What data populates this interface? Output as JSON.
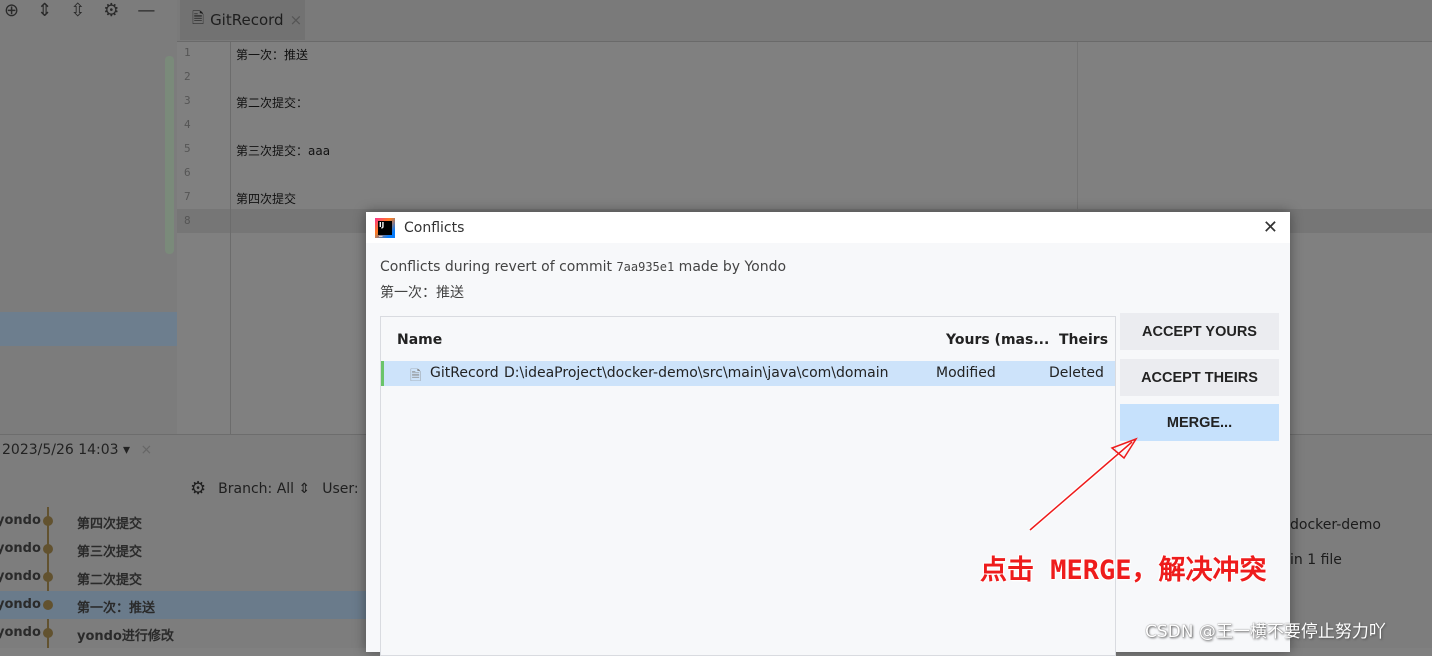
{
  "editor": {
    "tab_label": "GitRecord",
    "lines": [
      {
        "n": "1",
        "text": "第一次：推送"
      },
      {
        "n": "2",
        "text": ""
      },
      {
        "n": "3",
        "text": "第二次提交："
      },
      {
        "n": "4",
        "text": ""
      },
      {
        "n": "5",
        "text": "第三次提交：aaa"
      },
      {
        "n": "6",
        "text": ""
      },
      {
        "n": "7",
        "text": "第四次提交"
      },
      {
        "n": "8",
        "text": ""
      }
    ]
  },
  "log": {
    "date_filter": "2023/5/26 14:03",
    "branch_filter": "Branch: All",
    "user_filter": "User:",
    "commits": [
      {
        "author": "yondo",
        "message": "第四次提交"
      },
      {
        "author": "yondo",
        "message": "第三次提交"
      },
      {
        "author": "yondo",
        "message": "第二次提交"
      },
      {
        "author": "yondo",
        "message": "第一次：推送",
        "selected": true
      },
      {
        "author": "yondo",
        "message": "yondo进行修改"
      }
    ],
    "details": {
      "project": "docker-demo",
      "files": "in  1 file"
    }
  },
  "dialog": {
    "title": "Conflicts",
    "desc_prefix": "Conflicts during revert of commit ",
    "commit_hash": "7aa935e1",
    "desc_suffix": " made by Yondo",
    "commit_message": "第一次：推送",
    "columns": {
      "name": "Name",
      "yours": "Yours (mas...",
      "theirs": "Theirs"
    },
    "rows": [
      {
        "file": "GitRecord",
        "path": "D:\\ideaProject\\docker-demo\\src\\main\\java\\com\\domain",
        "yours": "Modified",
        "theirs": "Deleted"
      }
    ],
    "buttons": {
      "accept_yours": "ACCEPT YOURS",
      "accept_theirs": "ACCEPT THEIRS",
      "merge": "MERGE..."
    }
  },
  "annotation": "点击 MERGE，解决冲突",
  "watermark": "CSDN @王一横不要停止努力吖",
  "colors": {
    "annotation": "#ee1c1c",
    "selected_row": "#cde3fa",
    "merge_button": "#c6e1fc"
  }
}
